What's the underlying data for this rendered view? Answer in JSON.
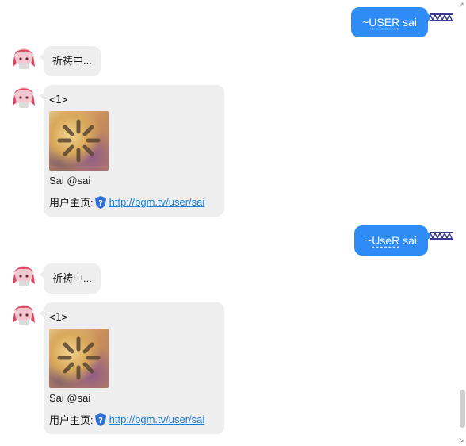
{
  "messages": [
    {
      "role": "user",
      "prefix": "~",
      "command": "USER",
      "arg": " sai"
    },
    {
      "role": "bot",
      "text": "祈祷中..."
    },
    {
      "role": "bot",
      "card": {
        "index": "<1>",
        "name": "Sai @sai",
        "home_label": "用户主页:",
        "link": "http://bgm.tv/user/sai"
      }
    },
    {
      "role": "user",
      "prefix": "~",
      "command": "UseR",
      "arg": " sai"
    },
    {
      "role": "bot",
      "text": "祈祷中..."
    },
    {
      "role": "bot",
      "card": {
        "index": "<1>",
        "name": "Sai @sai",
        "home_label": "用户主页:",
        "link": "http://bgm.tv/user/sai"
      }
    }
  ],
  "scrollbar": {
    "up_glyph": "↗",
    "down_glyph": "↘"
  },
  "colors": {
    "user_bubble": "#2f8cf6",
    "bot_bubble": "#eeeeee",
    "link": "#1d7fd6",
    "shield": "#2f6fd6"
  },
  "icons": {
    "bot_avatar": "anime-girl-avatar-icon",
    "user_avatar": "pixel-banner-avatar-icon",
    "shield": "question-shield-icon",
    "thumbnail_loading": "loading-spinner-icon"
  }
}
